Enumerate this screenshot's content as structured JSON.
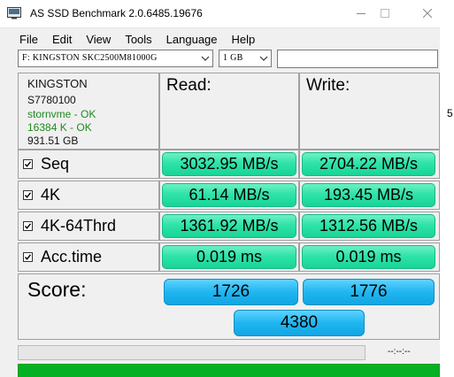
{
  "window": {
    "title": "AS SSD Benchmark 2.0.6485.19676"
  },
  "menu": [
    "File",
    "Edit",
    "View",
    "Tools",
    "Language",
    "Help"
  ],
  "toolbar": {
    "drive_select": "F: KINGSTON SKC2500M81000G",
    "size_select": "1 GB",
    "search_value": ""
  },
  "drive_info": {
    "model": "KINGSTON",
    "serial": "S7780100",
    "driver": "stornvme - OK",
    "alignment": "16384 K - OK",
    "capacity": "931.51 GB"
  },
  "headers": {
    "read": "Read:",
    "write": "Write:"
  },
  "tests": [
    {
      "label": "Seq",
      "checked": true,
      "read": "3032.95 MB/s",
      "write": "2704.22 MB/s"
    },
    {
      "label": "4K",
      "checked": true,
      "read": "61.14 MB/s",
      "write": "193.45 MB/s"
    },
    {
      "label": "4K-64Thrd",
      "checked": true,
      "read": "1361.92 MB/s",
      "write": "1312.56 MB/s"
    },
    {
      "label": "Acc.time",
      "checked": true,
      "read": "0.019 ms",
      "write": "0.019 ms"
    }
  ],
  "score": {
    "label": "Score:",
    "read": "1726",
    "write": "1776",
    "total": "4380"
  },
  "progress": {
    "fraction": 0,
    "elapsed": "--:--:--"
  },
  "status_progress": {
    "fraction": 1
  },
  "edge_text": "5",
  "colors": {
    "result_green": "#2fe3a8",
    "score_blue": "#1fb6f0",
    "status_green": "#06b025",
    "info_green": "#1e8a1e"
  },
  "icons": [
    "app-icon",
    "minimize-icon",
    "maximize-icon",
    "close-icon",
    "chevron-down-icon",
    "checkbox-checked-icon"
  ]
}
